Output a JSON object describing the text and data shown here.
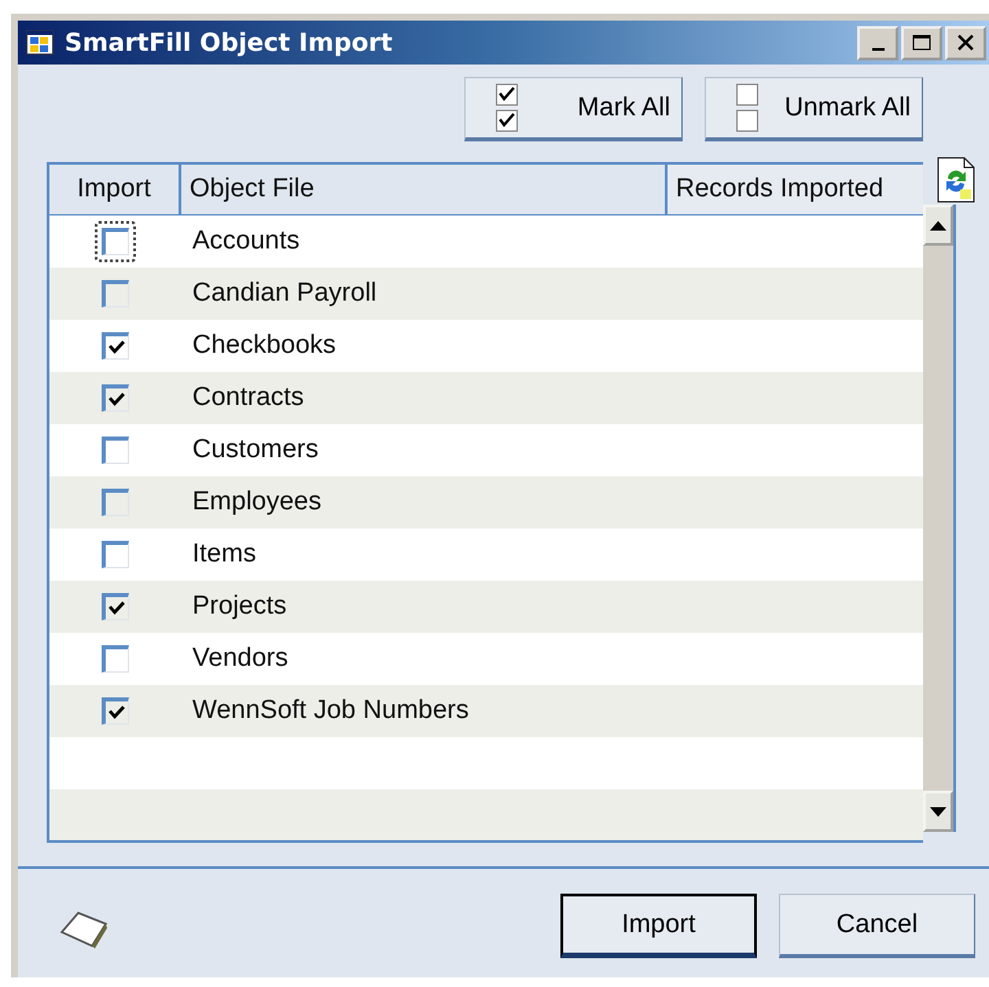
{
  "window": {
    "title": "SmartFill Object Import"
  },
  "toolbar": {
    "buttons": [
      {
        "label": "Mark All",
        "kind": "mark"
      },
      {
        "label": "Unmark All",
        "kind": "unmark"
      }
    ]
  },
  "table": {
    "columns": [
      "Import",
      "Object File",
      "Records Imported"
    ],
    "rows": [
      {
        "object_file": "Accounts",
        "checked": false,
        "focused": true
      },
      {
        "object_file": "Candian Payroll",
        "checked": false,
        "focused": false
      },
      {
        "object_file": "Checkbooks",
        "checked": true,
        "focused": false
      },
      {
        "object_file": "Contracts",
        "checked": true,
        "focused": false
      },
      {
        "object_file": "Customers",
        "checked": false,
        "focused": false
      },
      {
        "object_file": "Employees",
        "checked": false,
        "focused": false
      },
      {
        "object_file": "Items",
        "checked": false,
        "focused": false
      },
      {
        "object_file": "Projects",
        "checked": true,
        "focused": false
      },
      {
        "object_file": "Vendors",
        "checked": false,
        "focused": false
      },
      {
        "object_file": "WennSoft Job Numbers",
        "checked": true,
        "focused": false
      }
    ]
  },
  "footer": {
    "buttons": [
      {
        "label": "Import",
        "default": true
      },
      {
        "label": "Cancel",
        "default": false
      }
    ]
  }
}
